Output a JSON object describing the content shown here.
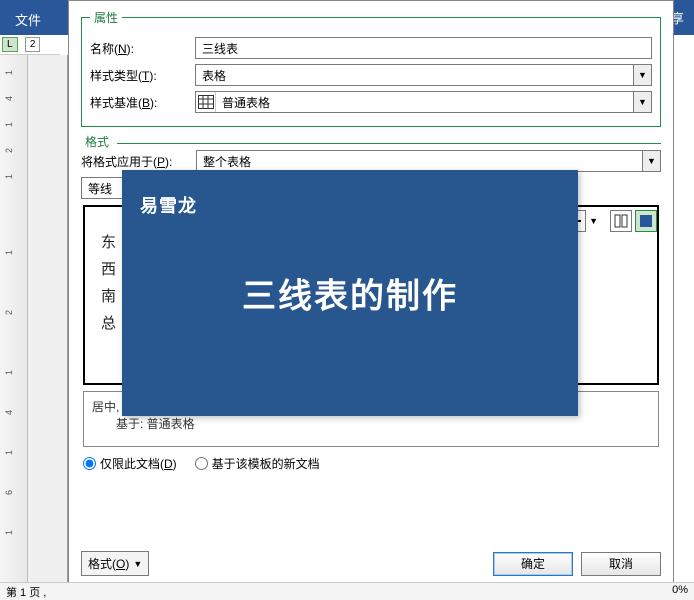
{
  "frame": {
    "file_btn": "文件",
    "share_hint": "享"
  },
  "ruler_tabs": {
    "l1": "L",
    "l2": "2"
  },
  "vruler_ticks": [
    "1",
    "4",
    "1",
    "2",
    "1",
    "1",
    "2",
    "1",
    "4",
    "1",
    "6",
    "1"
  ],
  "status": {
    "page": "第 1 页 ,",
    "zoom": "0%"
  },
  "properties": {
    "legend": "属性",
    "name_label_pre": "名称(",
    "name_label_u": "N",
    "name_label_post": "):",
    "name_value": "三线表",
    "styletype_label_pre": "样式类型(",
    "styletype_label_u": "T",
    "styletype_label_post": "):",
    "styletype_value": "表格",
    "baseon_label_pre": "样式基准(",
    "baseon_label_u": "B",
    "baseon_label_post": "):",
    "baseon_value": "普通表格"
  },
  "format": {
    "legend": "格式",
    "apply_label_pre": "将格式应用于(",
    "apply_label_u": "P",
    "apply_label_post": "):",
    "apply_value": "整个表格",
    "font_combo": "等线"
  },
  "preview_cells": [
    "东",
    "西",
    "南",
    "总"
  ],
  "overlay": {
    "logo": "易雪龙",
    "title": "三线表的制作"
  },
  "description": {
    "line1": "居中, 居中, 优先级: 100",
    "line2": "基于: 普通表格"
  },
  "scope": {
    "only_doc_pre": "仅限此文档(",
    "only_doc_u": "D",
    "only_doc_post": ")",
    "template_based": "基于该模板的新文档"
  },
  "bottom": {
    "format_btn_pre": "格式(",
    "format_btn_u": "O",
    "format_btn_post": ")",
    "ok": "确定",
    "cancel": "取消"
  }
}
